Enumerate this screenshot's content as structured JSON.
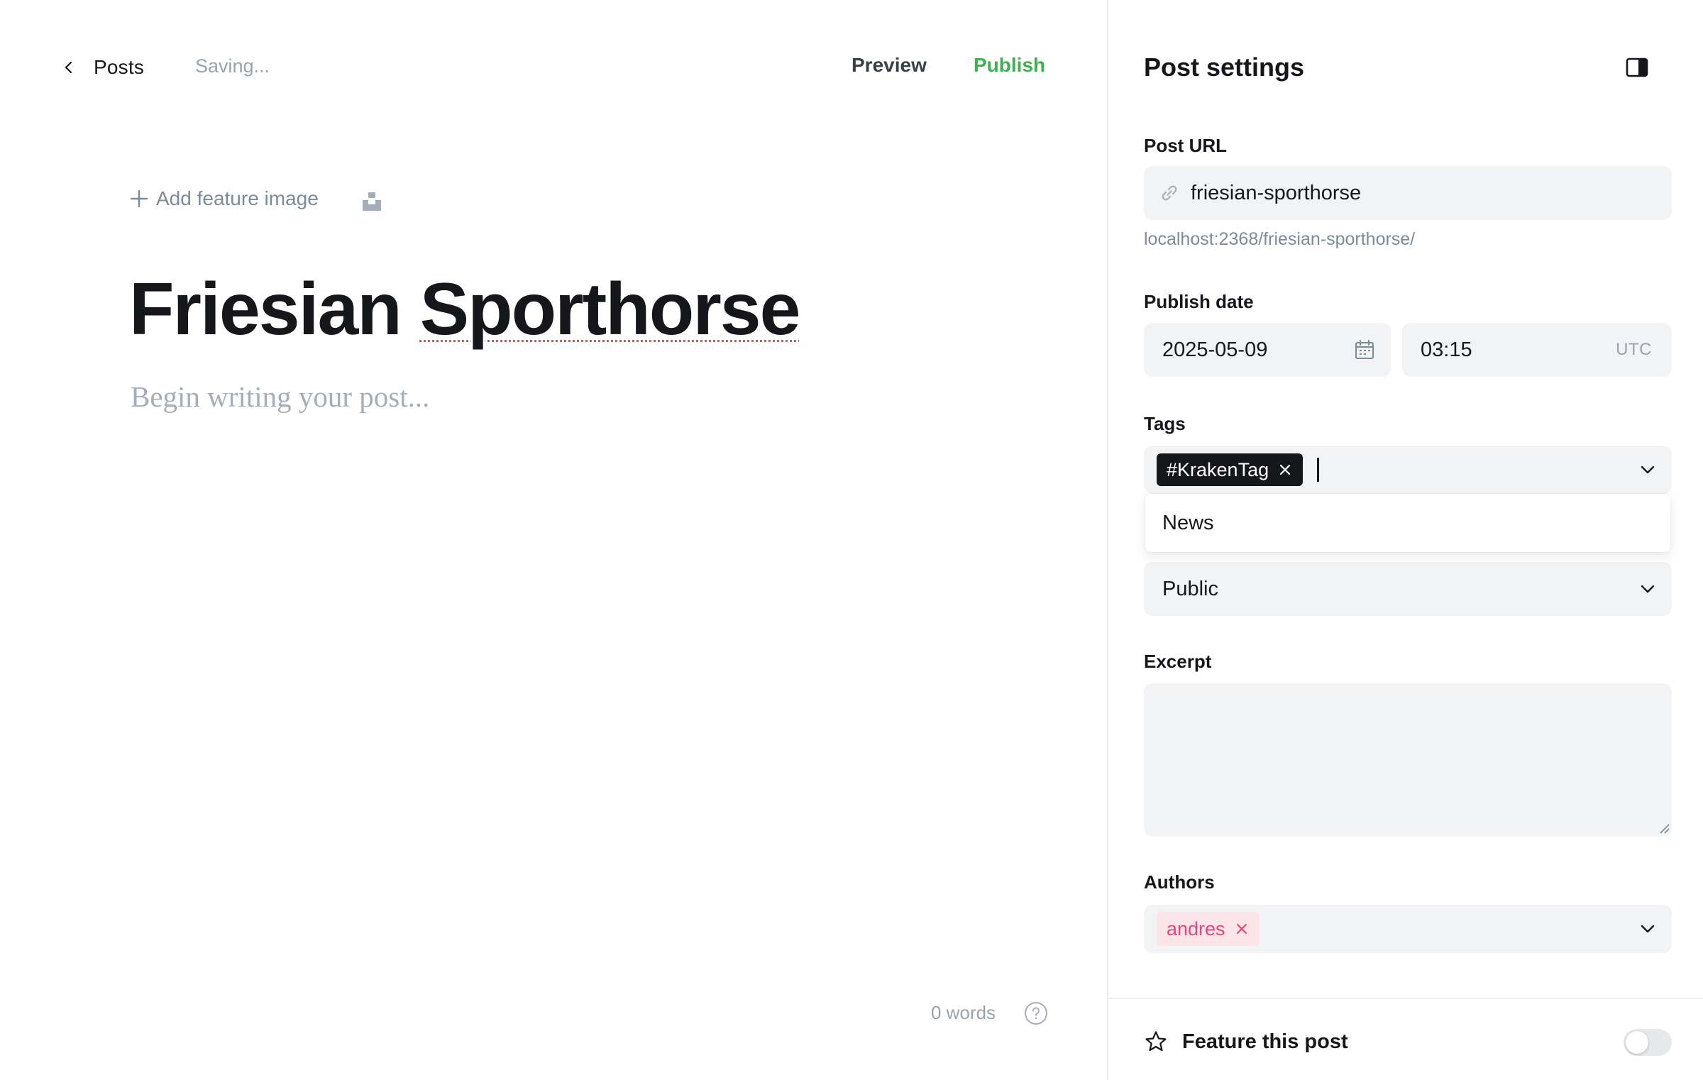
{
  "header": {
    "back_label": "Posts",
    "status": "Saving...",
    "preview_label": "Preview",
    "publish_label": "Publish"
  },
  "editor": {
    "feature_image_label": "Add feature image",
    "title_word1": "Friesian",
    "title_word2": "Sporthorse",
    "body_placeholder": "Begin writing your post...",
    "word_count": "0 words"
  },
  "settings": {
    "title": "Post settings",
    "post_url_label": "Post URL",
    "post_url_value": "friesian-sporthorse",
    "post_url_hint": "localhost:2368/friesian-sporthorse/",
    "publish_date_label": "Publish date",
    "date_value": "2025-05-09",
    "time_value": "03:15",
    "timezone": "UTC",
    "tags_label": "Tags",
    "tags": [
      "#KrakenTag"
    ],
    "tag_suggestions": [
      "News"
    ],
    "visibility_value": "Public",
    "excerpt_label": "Excerpt",
    "excerpt_value": "",
    "authors_label": "Authors",
    "authors": [
      "andres"
    ],
    "feature_post_label": "Feature this post",
    "feature_post_enabled": false
  },
  "colors": {
    "publish": "#3eb04f",
    "input_bg": "#f1f3f4",
    "tag_bg": "#15171a",
    "author_bg": "#fbe4ea",
    "author_text": "#e3467a",
    "muted": "#99a3ad"
  },
  "icons": {
    "back": "chevron-left-icon",
    "add": "plus-icon",
    "unsplash": "unsplash-icon",
    "help": "question-circle-icon",
    "panel": "sidebar-panel-icon",
    "link": "link-icon",
    "calendar": "calendar-icon",
    "dropdown": "chevron-down-icon",
    "remove": "close-icon",
    "feature": "star-icon"
  }
}
